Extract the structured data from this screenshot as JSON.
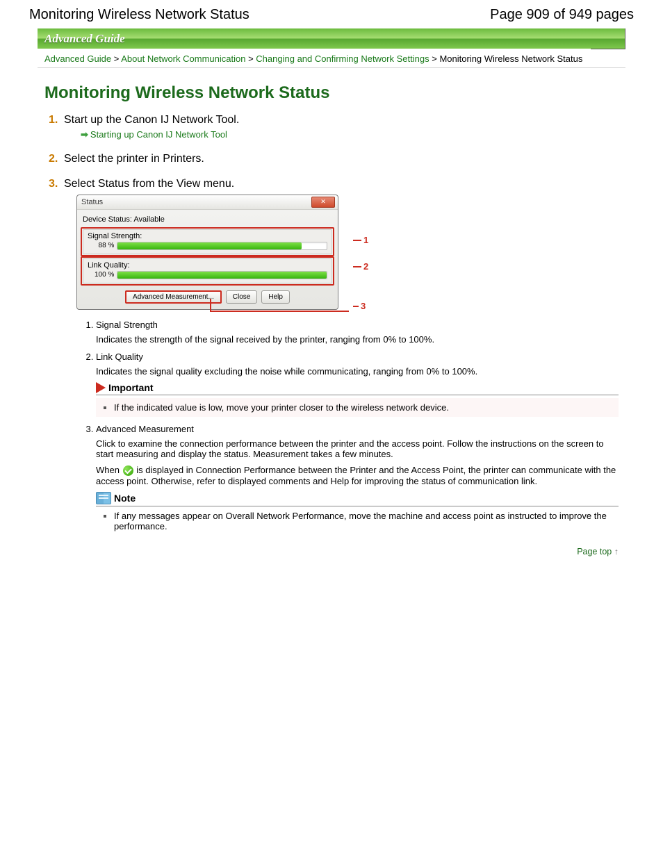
{
  "header": {
    "title_left": "Monitoring Wireless Network Status",
    "title_right": "Page 909 of 949 pages"
  },
  "banner": "Advanced Guide",
  "breadcrumbs": {
    "sep": " > ",
    "items": [
      "Advanced Guide",
      "About Network Communication",
      "Changing and Confirming Network Settings"
    ],
    "current": "Monitoring Wireless Network Status"
  },
  "article": {
    "title": "Monitoring Wireless Network Status",
    "steps": [
      {
        "text": "Start up the Canon IJ Network Tool.",
        "link": "Starting up Canon IJ Network Tool"
      },
      {
        "text": "Select the printer in Printers."
      },
      {
        "text": "Select Status from the View menu."
      }
    ],
    "dialog": {
      "title": "Status",
      "status_line": "Device Status: Available",
      "groups": {
        "signal": {
          "label": "Signal Strength:",
          "value": 88,
          "value_text": "88 %"
        },
        "link": {
          "label": "Link Quality:",
          "value": 100,
          "value_text": "100 %"
        }
      },
      "buttons": {
        "advanced": "Advanced Measurement...",
        "close": "Close",
        "help": "Help"
      },
      "callouts": [
        "1",
        "2",
        "3"
      ]
    },
    "explain": {
      "items": [
        {
          "heading": "Signal Strength",
          "body": "Indicates the strength of the signal received by the printer, ranging from 0% to 100%."
        },
        {
          "heading": "Link Quality",
          "body": "Indicates the signal quality excluding the noise while communicating, ranging from 0% to 100%."
        },
        {
          "heading": "Advanced Measurement",
          "body": "Click to examine the connection performance between the printer and the access point. Follow the instructions on the screen to start measuring and display the status. Measurement takes a few minutes.",
          "body2a": "When ",
          "body2b": " is displayed in Connection Performance between the Printer and the Access Point, the printer can communicate with the access point. Otherwise, refer to displayed comments and Help for improving the status of communication link."
        }
      ]
    },
    "important": {
      "title": "Important",
      "text": "If the indicated value is low, move your printer closer to the wireless network device."
    },
    "note": {
      "title": "Note",
      "text": "If any messages appear on Overall Network Performance, move the machine and access point as instructed to improve the performance."
    },
    "pagetop": "Page top",
    "pagetop_arrow": "↑"
  }
}
